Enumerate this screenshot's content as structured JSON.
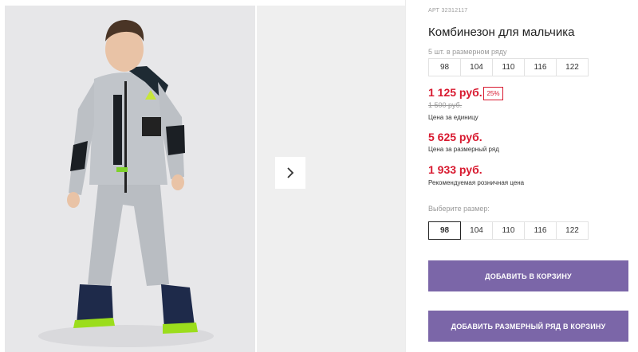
{
  "product": {
    "sku": "АРТ 32312117",
    "title": "Комбинезон для мальчика"
  },
  "size_row": {
    "note": "5 шт. в размерном ряду",
    "sizes": [
      "98",
      "104",
      "110",
      "116",
      "122"
    ]
  },
  "prices": {
    "unit_price": "1 125 руб.",
    "discount": "25%",
    "old_price": "1 500 руб.",
    "unit_label": "Цена за единицу",
    "row_price": "5 625 руб.",
    "row_label": "Цена за размерный ряд",
    "retail_price": "1 933 руб.",
    "retail_label": "Рекомендуемая розничная цена"
  },
  "size_select": {
    "label": "Выберите размер:",
    "sizes": [
      "98",
      "104",
      "110",
      "116",
      "122"
    ],
    "selected": "98"
  },
  "actions": {
    "add_to_cart": "Добавить в корзину",
    "add_row_to_cart": "Добавить размерный ряд в корзину"
  },
  "gallery": {
    "next_icon": "chevron-right-icon",
    "main_image": "boy-in-gray-jumpsuit-photo",
    "next_image": "next-product-photo"
  },
  "colors": {
    "accent": "#7b66a8",
    "price": "#d8192f"
  }
}
